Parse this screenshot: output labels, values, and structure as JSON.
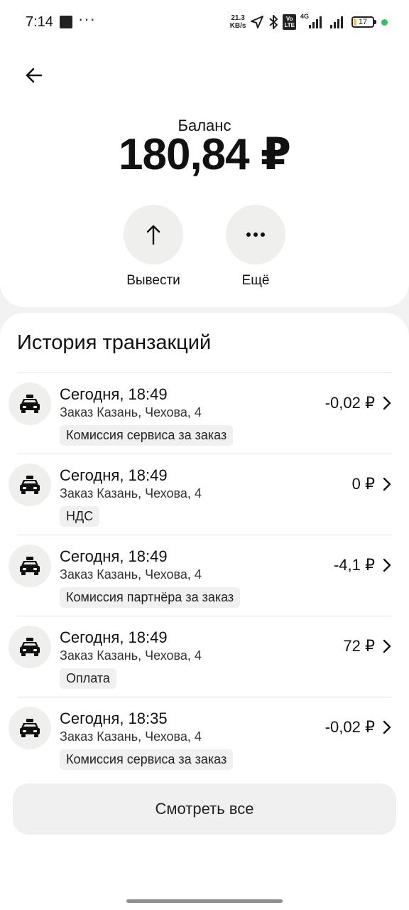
{
  "status_bar": {
    "time": "7:14",
    "network_speed_value": "21.3",
    "network_speed_unit": "KB/s",
    "volte_top": "Vo",
    "volte_bottom": "LTE",
    "network_type": "4G",
    "battery_level": "17",
    "battery_fraction": 0.17
  },
  "header": {
    "balance_label": "Баланс",
    "balance_value": "180,84 ₽"
  },
  "actions": {
    "withdraw_label": "Вывести",
    "withdraw_glyph": "↑",
    "more_label": "Ещё",
    "more_glyph": "•••"
  },
  "transactions": {
    "title": "История транзакций",
    "items": [
      {
        "date": "Сегодня, 18:49",
        "description": "Заказ Казань, Чехова, 4",
        "tag": "Комиссия сервиса за заказ",
        "amount": "-0,02 ₽"
      },
      {
        "date": "Сегодня, 18:49",
        "description": "Заказ Казань, Чехова, 4",
        "tag": "НДС",
        "amount": "0 ₽"
      },
      {
        "date": "Сегодня, 18:49",
        "description": "Заказ Казань, Чехова, 4",
        "tag": "Комиссия партнёра за заказ",
        "amount": "-4,1 ₽"
      },
      {
        "date": "Сегодня, 18:49",
        "description": "Заказ Казань, Чехова, 4",
        "tag": "Оплата",
        "amount": "72 ₽"
      },
      {
        "date": "Сегодня, 18:35",
        "description": "Заказ Казань, Чехова, 4",
        "tag": "Комиссия сервиса за заказ",
        "amount": "-0,02 ₽"
      }
    ],
    "see_all_label": "Смотреть все"
  },
  "icons": {
    "back": "arrow-left-icon",
    "transaction": "taxi-car-icon",
    "chevron": "chevron-right-icon"
  },
  "colors": {
    "background": "#f2f2f2",
    "card": "#ffffff",
    "circle": "#efefee",
    "tag_bg": "#f0f0f0",
    "status_dot": "#35c15c"
  }
}
